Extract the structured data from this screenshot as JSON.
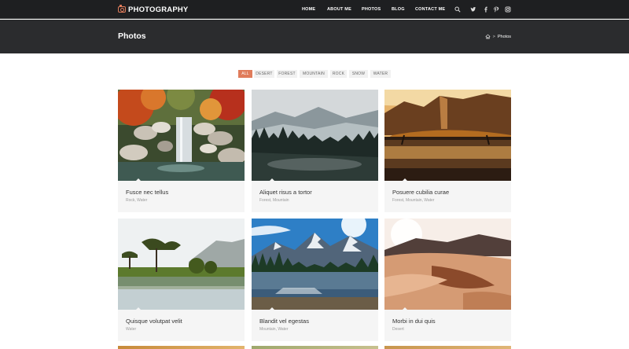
{
  "brand": {
    "name": "PHOTOGRAPHY",
    "icon": "camera-icon",
    "accent": "#e07c5b"
  },
  "nav": {
    "links": [
      "HOME",
      "ABOUT ME",
      "PHOTOS",
      "BLOG",
      "CONTACT ME"
    ],
    "icons": [
      "search-icon",
      "twitter-icon",
      "facebook-icon",
      "pinterest-icon",
      "instagram-icon"
    ]
  },
  "page": {
    "title": "Photos",
    "breadcrumb": {
      "home_icon": "home-icon",
      "separator": ">",
      "current": "Photos"
    }
  },
  "filters": [
    "ALL",
    "DESERT",
    "FOREST",
    "MOUNTAIN",
    "ROCK",
    "SNOW",
    "WATER"
  ],
  "active_filter": "ALL",
  "gallery": [
    {
      "title": "Fusce nec tellus",
      "tags": "Rock, Water"
    },
    {
      "title": "Aliquet risus a tortor",
      "tags": "Forest, Mountain"
    },
    {
      "title": "Posuere cubilia curae",
      "tags": "Forest, Mountain, Water"
    },
    {
      "title": "Quisque volutpat velit",
      "tags": "Water"
    },
    {
      "title": "Blandit vel egestas",
      "tags": "Mountain, Water"
    },
    {
      "title": "Morbi in dui quis",
      "tags": "Desert"
    }
  ]
}
